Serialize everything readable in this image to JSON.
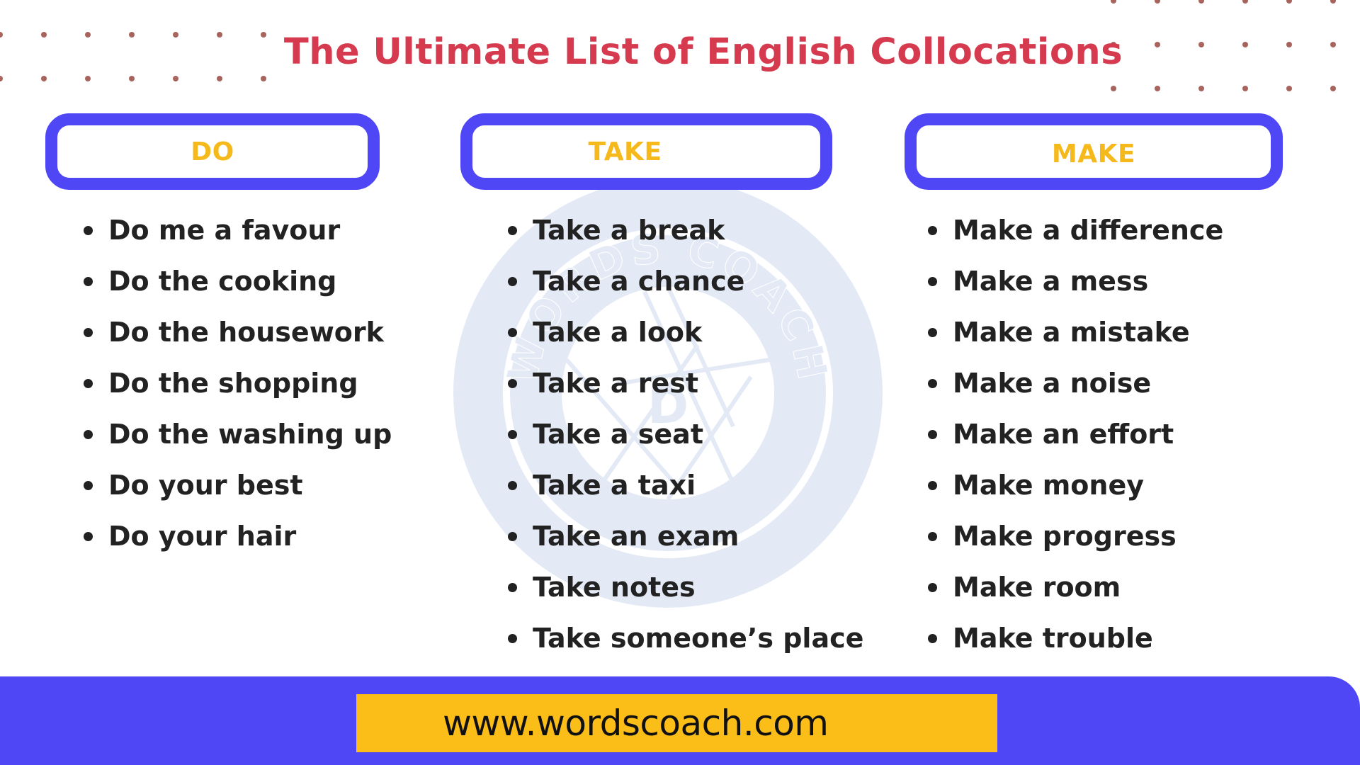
{
  "title": "The Ultimate List of English Collocations",
  "colors": {
    "title": "#d63a4e",
    "accent_blue": "#4f46f5",
    "heading_yellow": "#f6b91b",
    "footer_yellow": "#fbbd17",
    "dots": "#a8635c",
    "text": "#222222",
    "watermark": "#e4eaf5"
  },
  "watermark": {
    "text": "WORDS COACH",
    "letter": "D",
    "icon": "camera-aperture-logo"
  },
  "columns": [
    {
      "heading": "DO",
      "items": [
        "Do me a favour",
        "Do the cooking",
        "Do the housework",
        "Do the shopping",
        "Do the washing up",
        "Do your best",
        "Do your hair"
      ]
    },
    {
      "heading": "TAKE",
      "items": [
        "Take a break",
        "Take a chance",
        "Take a look",
        "Take a rest",
        "Take a seat",
        "Take a taxi",
        "Take an exam",
        "Take notes",
        "Take someone’s place"
      ]
    },
    {
      "heading": "MAKE",
      "items": [
        "Make a difference",
        "Make a mess",
        "Make a mistake",
        "Make a noise",
        "Make an effort",
        "Make money",
        "Make progress",
        "Make room",
        "Make trouble"
      ]
    }
  ],
  "footer": {
    "url": "www.wordscoach.com"
  }
}
